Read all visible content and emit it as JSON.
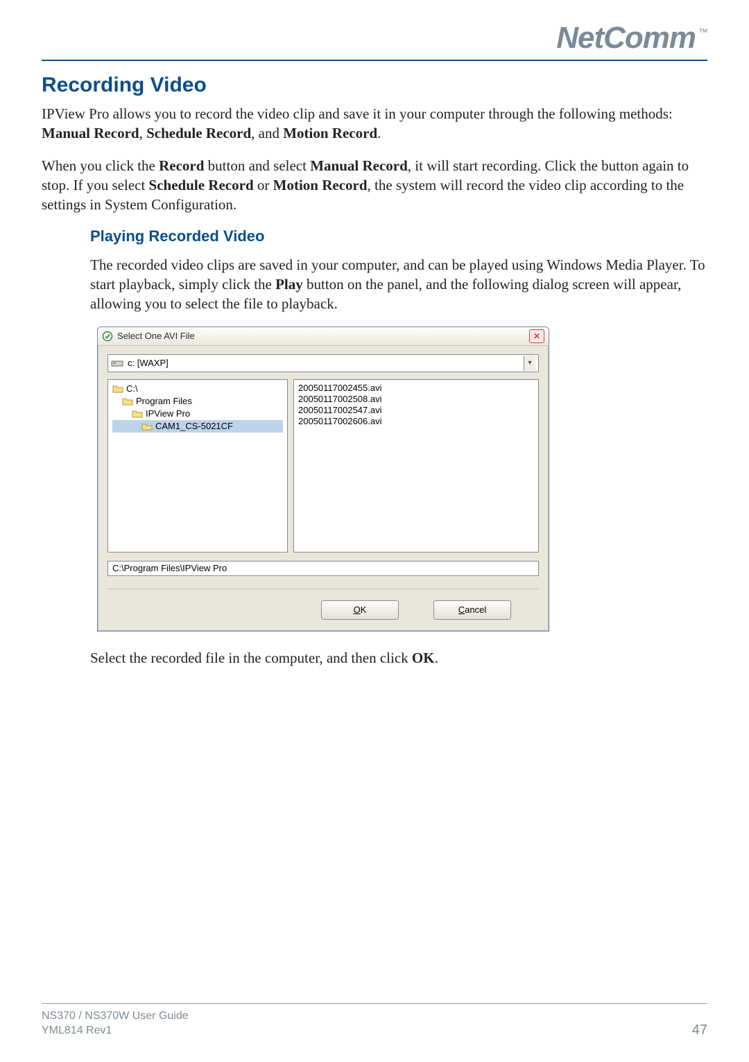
{
  "header": {
    "logo_text": "NetComm",
    "logo_tm": "™"
  },
  "section": {
    "title": "Recording Video",
    "p1_prefix": "IPView Pro allows you to record the video clip and save it in your computer through the following methods: ",
    "p1_b1": "Manual Record",
    "p1_sep1": ", ",
    "p1_b2": "Schedule Record",
    "p1_sep2": ", and ",
    "p1_b3": "Motion Record",
    "p1_suffix": ".",
    "p2_a": "When you click the ",
    "p2_b1": "Record",
    "p2_b": " button and select ",
    "p2_b2": "Manual Record",
    "p2_c": ", it will start recording.  Click the button again to stop.  If you select ",
    "p2_b3": "Schedule Record",
    "p2_d": " or ",
    "p2_b4": "Motion Record",
    "p2_e": ", the system will record the video clip according to the settings in System Configuration."
  },
  "sub": {
    "title": "Playing Recorded Video",
    "p1_a": "The recorded video clips are saved in your computer, and can be played using Windows Media Player.  To start playback, simply click the ",
    "p1_b1": "Play",
    "p1_b": " button on the panel, and the following dialog screen will appear, allowing you to select the file to playback.",
    "p2_a": "Select the recorded file in the computer, and then click ",
    "p2_b1": "OK",
    "p2_b": "."
  },
  "dialog": {
    "title": "Select One AVI File",
    "drive_label": "c: [WAXP]",
    "tree": {
      "root": "C:\\",
      "l1": "Program Files",
      "l2": "IPView Pro",
      "l3": "CAM1_CS-5021CF"
    },
    "files": [
      "20050117002455.avi",
      "20050117002508.avi",
      "20050117002547.avi",
      "20050117002606.avi"
    ],
    "path_value": "C:\\Program Files\\IPView Pro",
    "ok_u": "O",
    "ok_rest": "K",
    "cancel_u": "C",
    "cancel_rest": "ancel"
  },
  "footer": {
    "line1": "NS370 / NS370W User Guide",
    "line2": "YML814 Rev1",
    "page": "47"
  }
}
